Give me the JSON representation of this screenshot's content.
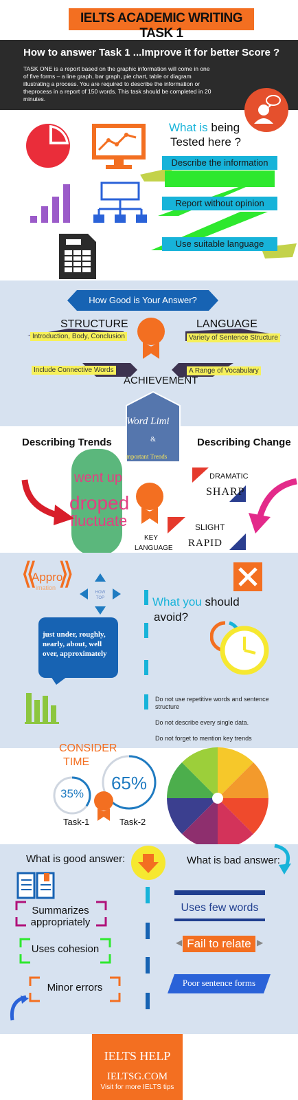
{
  "header": {
    "title": "IELTS ACADEMIC WRITING TASK 1",
    "subtitle": "How to answer Task 1 ...Improve it for better Score ?",
    "intro": "TASK ONE is a report based on the graphic information will come in one of five forms – a line graph, bar graph, pie chart, table or diagram illustrating a process. You are required to describe the information or theprocess in a report of 150 words. This task should be completed in 20 minutes."
  },
  "tested": {
    "title_highlight": "What is",
    "title_rest": "being",
    "title_line2": "Tested here ?",
    "items": [
      "Describe the information",
      "Report without opinion",
      "Use suitable language"
    ]
  },
  "how_good": {
    "banner": "How Good is Your Answer?",
    "structure": "STRUCTURE",
    "language": "LANGUAGE",
    "achievement": "ACHIEVEMENT",
    "left_items": [
      "Introduction, Body, Conclusion",
      "Include Connective Words"
    ],
    "right_items": [
      "Variety of Sentence Structure",
      "A Range of Vocabulary"
    ]
  },
  "trends": {
    "trends_title": "Describing Trends",
    "change_title": "Describing Change",
    "pentagon_line1": "Word Limi",
    "pentagon_amp": "&",
    "pentagon_line3": "mportant  Trends",
    "words": [
      "went up",
      "droped",
      "fluctuate"
    ],
    "key_label_1": "KEY",
    "key_label_2": "LANGUAGE",
    "change_words": [
      "DRAMATIC",
      "SHARP",
      "SLIGHT",
      "RAPID"
    ]
  },
  "avoid": {
    "approx_title": "Appro",
    "approx_sub": "imation",
    "how_top": "HOW\nTOP",
    "bubble": "just under, roughly, nearly, about, well over, approximately",
    "title_highlight": "What you",
    "title_rest": "should",
    "title_line2": "avoid?",
    "items": [
      "Do not use repetitive words and sentence structure",
      "Do not describe every single data.",
      "Do not forget to mention key trends"
    ]
  },
  "time": {
    "title_1": "CONSIDER",
    "title_2": "TIME",
    "task1_pct": "35%",
    "task2_pct": "65%",
    "task1_label": "Task-1",
    "task2_label": "Task-2",
    "task1_value": 35,
    "task2_value": 65
  },
  "answers": {
    "good_title": "What is good answer:",
    "bad_title": "What is bad answer:",
    "good_items": [
      "Summarizes appropriately",
      "Uses cohesion",
      "Minor errors"
    ],
    "bad_items": [
      "Uses few words",
      "Fail to relate",
      "Poor sentence forms"
    ]
  },
  "footer": {
    "title": "IELTS HELP",
    "site": "IELTSG.COM",
    "tagline": "Visit for more IELTS tips"
  },
  "colors": {
    "orange": "#f36f21",
    "blue": "#17b3d9",
    "green": "#2ee82e",
    "dark": "#2b2b2b",
    "light_blue_bg": "#d7e2f0"
  }
}
